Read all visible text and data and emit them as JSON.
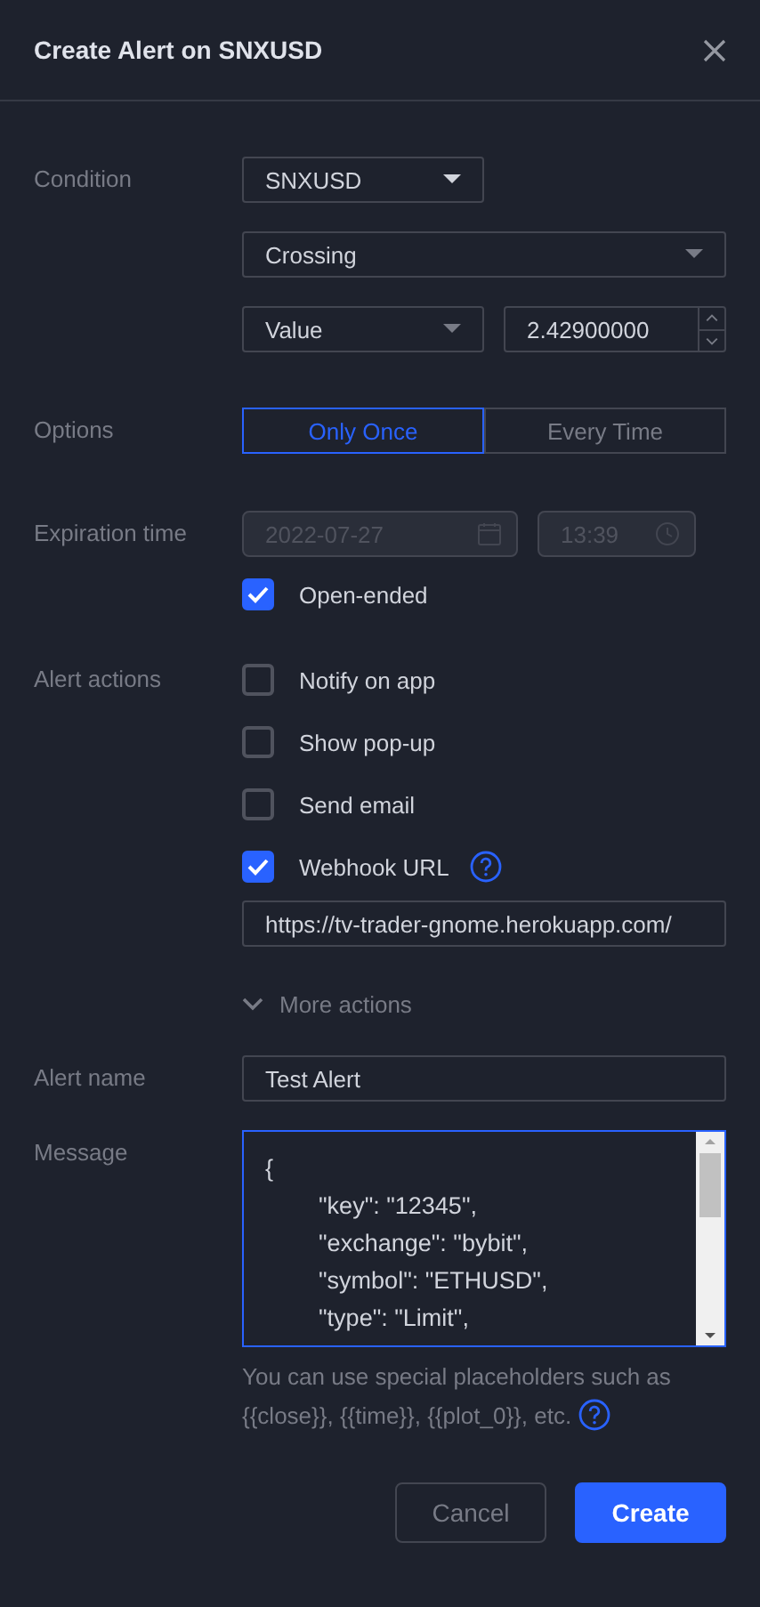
{
  "window": {
    "title": "Create Alert on SNXUSD"
  },
  "condition": {
    "label": "Condition",
    "symbol": "SNXUSD",
    "operator": "Crossing",
    "source": "Value",
    "value": "2.42900000"
  },
  "options": {
    "label": "Options",
    "choices": [
      {
        "label": "Only Once",
        "selected": true
      },
      {
        "label": "Every Time",
        "selected": false
      }
    ]
  },
  "expiration": {
    "label": "Expiration time",
    "date": "2022-07-27",
    "time": "13:39",
    "disabled": true,
    "open_ended": {
      "label": "Open-ended",
      "checked": true
    }
  },
  "alert_actions": {
    "label": "Alert actions",
    "items": [
      {
        "label": "Notify on app",
        "checked": false,
        "help": false
      },
      {
        "label": "Show pop-up",
        "checked": false,
        "help": false
      },
      {
        "label": "Send email",
        "checked": false,
        "help": false
      },
      {
        "label": "Webhook URL",
        "checked": true,
        "help": true
      }
    ],
    "webhook_url": "https://tv-trader-gnome.herokuapp.com/",
    "more_actions": "More actions"
  },
  "alert_name": {
    "label": "Alert name",
    "value": "Test Alert"
  },
  "message": {
    "label": "Message",
    "value": "{\n\t\"key\": \"12345\",\n\t\"exchange\": \"bybit\",\n\t\"symbol\": \"ETHUSD\",\n\t\"type\": \"Limit\",",
    "hint_lines": [
      "You can use special placeholders such as",
      "{{close}}, {{time}}, {{plot_0}}, etc."
    ]
  },
  "buttons": [
    {
      "label": "Cancel",
      "kind": "secondary"
    },
    {
      "label": "Create",
      "kind": "primary"
    }
  ]
}
